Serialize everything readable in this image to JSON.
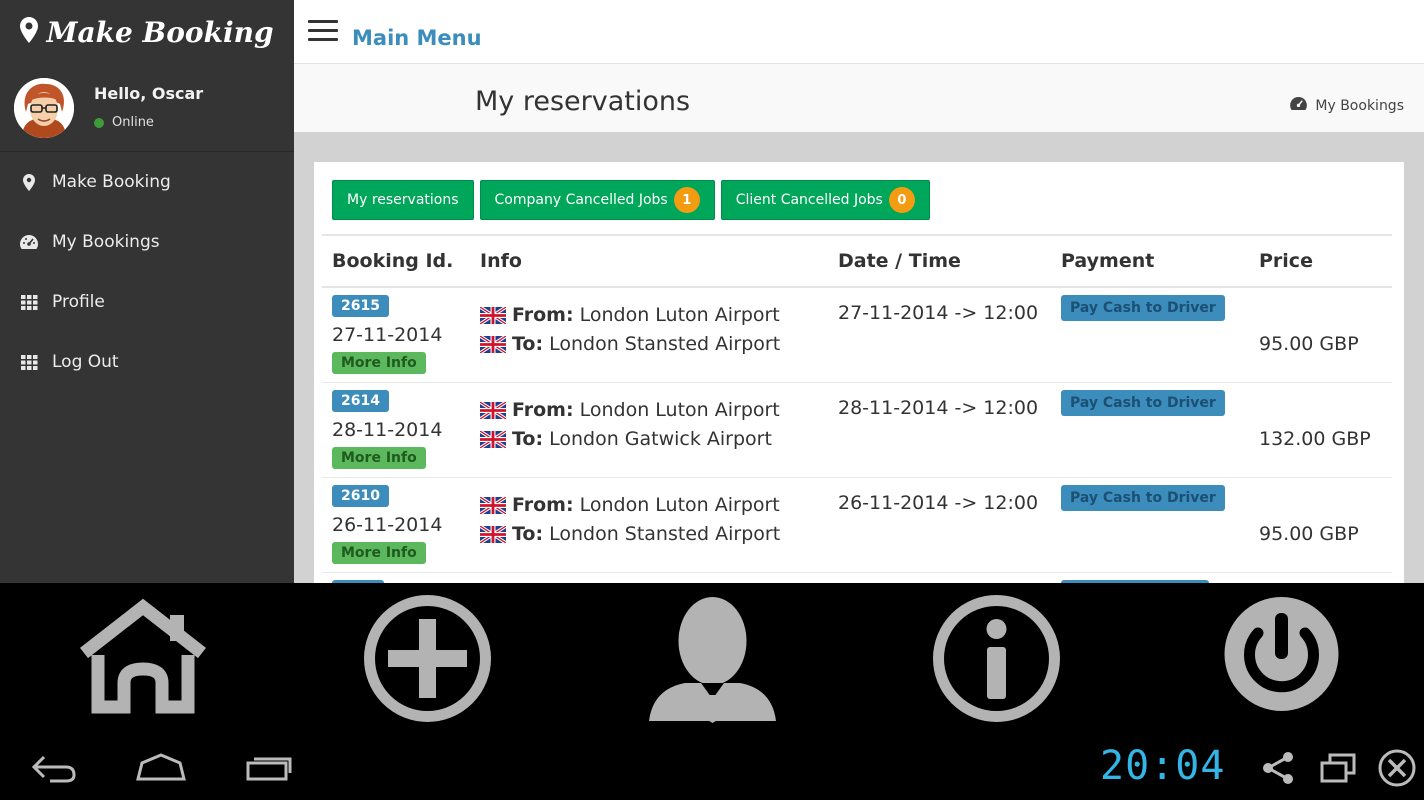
{
  "sidebar": {
    "brand": "Make Booking",
    "user": {
      "greeting": "Hello, Oscar",
      "status": "Online"
    },
    "items": [
      {
        "label": "Make Booking",
        "icon": "map-marker-icon"
      },
      {
        "label": "My Bookings",
        "icon": "dashboard-icon"
      },
      {
        "label": "Profile",
        "icon": "grid-icon"
      },
      {
        "label": "Log Out",
        "icon": "grid-icon"
      }
    ]
  },
  "header": {
    "menu_title": "Main Menu"
  },
  "content": {
    "page_title": "My reservations",
    "breadcrumb": "My Bookings"
  },
  "tabs": [
    {
      "label": "My reservations"
    },
    {
      "label": "Company Cancelled Jobs",
      "count": "1"
    },
    {
      "label": "Client Cancelled Jobs",
      "count": "0"
    }
  ],
  "table": {
    "headers": [
      "Booking Id.",
      "Info",
      "Date / Time",
      "Payment",
      "Price"
    ],
    "from_label": "From:",
    "to_label": "To:",
    "more_label": "More Info",
    "rows": [
      {
        "id": "2615",
        "date": "27-11-2014",
        "from": "London Luton Airport",
        "to": "London Stansted Airport",
        "datetime": "27-11-2014 -> 12:00",
        "payment": "Pay Cash to Driver",
        "price": "95.00 GBP"
      },
      {
        "id": "2614",
        "date": "28-11-2014",
        "from": "London Luton Airport",
        "to": "London Gatwick Airport",
        "datetime": "28-11-2014 -> 12:00",
        "payment": "Pay Cash to Driver",
        "price": "132.00 GBP"
      },
      {
        "id": "2610",
        "date": "26-11-2014",
        "from": "London Luton Airport",
        "to": "London Stansted Airport",
        "datetime": "26-11-2014 -> 12:00",
        "payment": "Pay Cash to Driver",
        "price": "95.00 GBP"
      }
    ]
  },
  "dock": [
    "home-icon",
    "add-icon",
    "user-icon",
    "info-icon",
    "power-icon"
  ],
  "system_bar": {
    "clock": "20:04"
  },
  "colors": {
    "sidebar": "#343434",
    "accent": "#3c8dbc",
    "success": "#00a65a",
    "badge": "#f39c12",
    "clock": "#33b5e5"
  }
}
